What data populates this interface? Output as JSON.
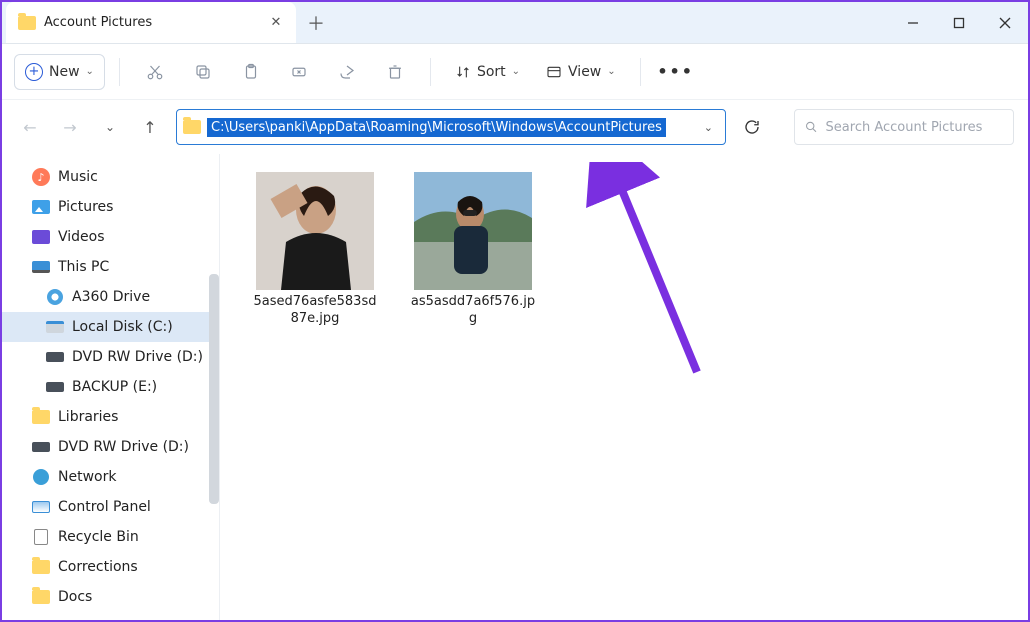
{
  "titlebar": {
    "tab_title": "Account Pictures"
  },
  "toolbar": {
    "new_label": "New",
    "sort_label": "Sort",
    "view_label": "View"
  },
  "navbar": {
    "address": "C:\\Users\\panki\\AppData\\Roaming\\Microsoft\\Windows\\AccountPictures",
    "search_placeholder": "Search Account Pictures"
  },
  "sidebar": {
    "items": [
      {
        "label": "Music",
        "icon": "music",
        "indent": false
      },
      {
        "label": "Pictures",
        "icon": "pic",
        "indent": false
      },
      {
        "label": "Videos",
        "icon": "vid",
        "indent": false
      },
      {
        "label": "This PC",
        "icon": "pc",
        "indent": false
      },
      {
        "label": "A360 Drive",
        "icon": "a360",
        "indent": true
      },
      {
        "label": "Local Disk (C:)",
        "icon": "disk",
        "indent": true,
        "selected": true
      },
      {
        "label": "DVD RW Drive (D:)",
        "icon": "drive",
        "indent": true
      },
      {
        "label": "BACKUP (E:)",
        "icon": "drive",
        "indent": true
      },
      {
        "label": "Libraries",
        "icon": "folder",
        "indent": false
      },
      {
        "label": "DVD RW Drive (D:)",
        "icon": "drive",
        "indent": false
      },
      {
        "label": "Network",
        "icon": "net",
        "indent": false
      },
      {
        "label": "Control Panel",
        "icon": "cp",
        "indent": false
      },
      {
        "label": "Recycle Bin",
        "icon": "bin",
        "indent": false
      },
      {
        "label": "Corrections",
        "icon": "folder",
        "indent": false
      },
      {
        "label": "Docs",
        "icon": "folder",
        "indent": false
      }
    ]
  },
  "files": [
    {
      "name": "5ased76asfe583sd87e.jpg"
    },
    {
      "name": "as5asdd7a6f576.jpg"
    }
  ]
}
